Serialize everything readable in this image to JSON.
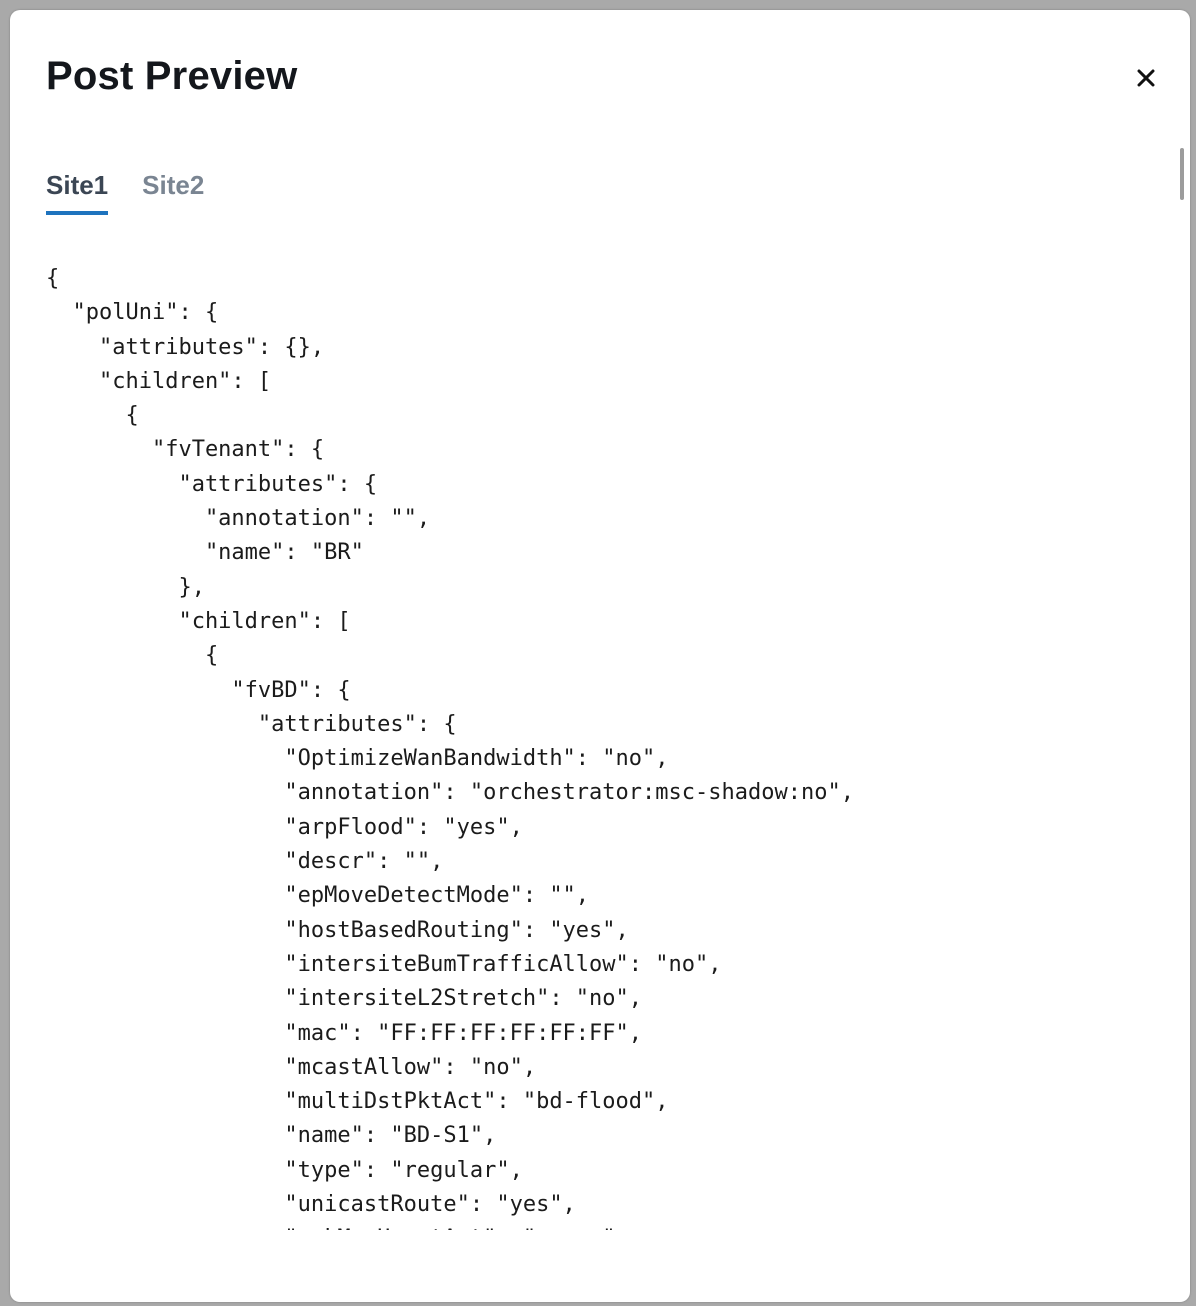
{
  "modal": {
    "title": "Post Preview",
    "close_icon": "close-icon"
  },
  "tabs": [
    {
      "label": "Site1",
      "active": true
    },
    {
      "label": "Site2",
      "active": false
    }
  ],
  "preview": {
    "code": "{\n  \"polUni\": {\n    \"attributes\": {},\n    \"children\": [\n      {\n        \"fvTenant\": {\n          \"attributes\": {\n            \"annotation\": \"\",\n            \"name\": \"BR\"\n          },\n          \"children\": [\n            {\n              \"fvBD\": {\n                \"attributes\": {\n                  \"OptimizeWanBandwidth\": \"no\",\n                  \"annotation\": \"orchestrator:msc-shadow:no\",\n                  \"arpFlood\": \"yes\",\n                  \"descr\": \"\",\n                  \"epMoveDetectMode\": \"\",\n                  \"hostBasedRouting\": \"yes\",\n                  \"intersiteBumTrafficAllow\": \"no\",\n                  \"intersiteL2Stretch\": \"no\",\n                  \"mac\": \"FF:FF:FF:FF:FF:FF\",\n                  \"mcastAllow\": \"no\",\n                  \"multiDstPktAct\": \"bd-flood\",\n                  \"name\": \"BD-S1\",\n                  \"type\": \"regular\",\n                  \"unicastRoute\": \"yes\",\n                  \"unkMacUcastAct\": \"proxy\""
  },
  "colors": {
    "accent": "#1e73be",
    "title": "#14171c",
    "tab_active": "#3b4654",
    "tab_inactive": "#7a8592"
  }
}
